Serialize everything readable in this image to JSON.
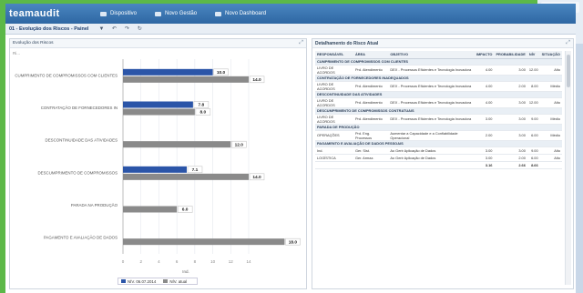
{
  "app": {
    "logo": "teamaudit",
    "menu": [
      "Dispositivo",
      "Novo Gestão",
      "Novo Dashboard"
    ]
  },
  "toolbar": {
    "title": "01 - Evolução dos Riscos - Painel",
    "tools": [
      "filter-icon",
      "undo-icon",
      "redo-icon",
      "refresh-icon"
    ]
  },
  "left_panel": {
    "title": "Evolução dos Riscos",
    "filter_label": "Ri..."
  },
  "chart_data": {
    "type": "bar",
    "orientation": "horizontal",
    "categories": [
      "CUMPRIMENTO DE COMPROMISSOS COM CLIENTES",
      "CONTRATAÇÃO DE FORNECEDORES IN",
      "DESCONTINUIDADE DAS ATIVIDADES",
      "DESCUMPRIMENTO DE COMPROMISSOS",
      "PARADA NA PRODUÇÃO",
      "PAGAMENTO E AVALIAÇÃO DE DADOS"
    ],
    "series": [
      {
        "name": "Atual",
        "color": "#2b55a8",
        "values": [
          10.0,
          7.8,
          null,
          7.1,
          null,
          null
        ]
      },
      {
        "name": "Anterior",
        "color": "#8a8a8a",
        "values": [
          14.0,
          8.0,
          12.0,
          14.0,
          6.0,
          18.0
        ]
      }
    ],
    "value_labels": [
      [
        "10.0",
        "14.0"
      ],
      [
        "7.8",
        "8.0"
      ],
      [
        null,
        "12.0"
      ],
      [
        "7.1",
        "14.0"
      ],
      [
        null,
        "6.0"
      ],
      [
        null,
        "18.0"
      ]
    ],
    "xlim": [
      0,
      14
    ],
    "xticks": [
      "0",
      "2",
      "4",
      "6",
      "8",
      "10",
      "12",
      "14"
    ],
    "xlabel": "Ind.",
    "legend": [
      "NÍV. 06.07.2014",
      "NÍV. atual"
    ],
    "legend_position": "bottom"
  },
  "right_panel": {
    "title": "Detalhamento do Risco Atual",
    "columns": [
      "RESPONSÁVEL",
      "ÁREA",
      "OBJETIVO",
      "IMPACTO",
      "PROBABILIDADE",
      "NÍV",
      "SITUAÇÃO"
    ],
    "groups": [
      {
        "name": "CUMPRIMENTO DE COMPROMISSOS COM CLIENTES",
        "rows": [
          [
            "LIVRO DE ACORDOS",
            "Prd. Atendimento",
            "DEX - Processos Eficientes e Tecnologia Inovadora",
            "4.00",
            "3.00",
            "12.00",
            "Alto"
          ]
        ]
      },
      {
        "name": "CONTRATAÇÃO DE FORNECEDORES INADEQUADOS",
        "rows": [
          [
            "LIVRO DE ACORDOS",
            "Prd. Atendimento",
            "DEX - Processos Eficientes e Tecnologia Inovadora",
            "4.00",
            "2.00",
            "8.00",
            "Médio"
          ]
        ]
      },
      {
        "name": "DESCONTINUIDADE DAS ATIVIDADES",
        "rows": [
          [
            "LIVRO DE ACORDOS",
            "Prd. Atendimento",
            "DEX - Processos Eficientes e Tecnologia Inovadora",
            "4.00",
            "3.00",
            "12.00",
            "Alto"
          ]
        ]
      },
      {
        "name": "DESCUMPRIMENTO DE COMPROMISSOS CONTRATUAIS",
        "rows": [
          [
            "LIVRO DE ACORDOS",
            "Prd. Atendimento",
            "DEX - Processos Eficientes e Tecnologia Inovadora",
            "3.00",
            "3.00",
            "9.00",
            "Médio"
          ]
        ]
      },
      {
        "name": "PARADA DE PRODUÇÃO",
        "rows": [
          [
            "OPERAÇÕES",
            "Prd. Eng. Processos",
            "Aumentar a Capacidade e a Confiabilidade Operacional",
            "2.00",
            "3.00",
            "6.00",
            "Médio"
          ]
        ]
      },
      {
        "name": "PAGAMENTO E AVALIAÇÃO DE DADOS PESSOAIS",
        "rows": [
          [
            "Ind.",
            "Ger. Sist.",
            "Ao Gerir Aplicação de Dados",
            "3.00",
            "3.00",
            "9.00",
            "Alto"
          ],
          [
            "LOGÍSTICA",
            "Ger. Armaz.",
            "Ao Gerir Aplicação de Dados",
            "3.00",
            "2.00",
            "6.00",
            "Alto"
          ]
        ]
      }
    ],
    "total": [
      "",
      "",
      "",
      "3.16",
      "2.66",
      "8.66",
      ""
    ]
  }
}
